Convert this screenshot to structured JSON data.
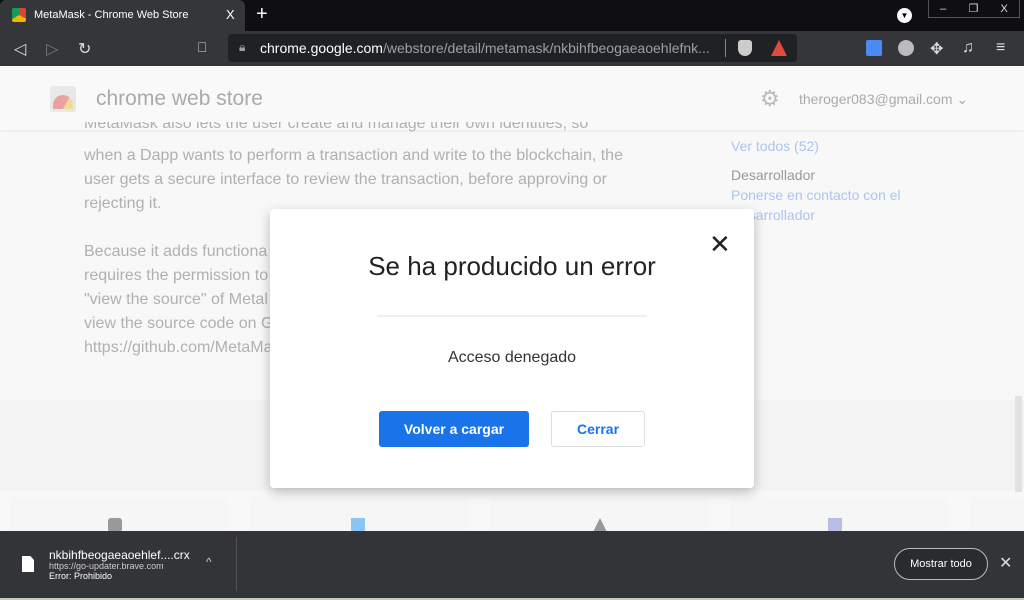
{
  "browser": {
    "tab_title": "MetaMask - Chrome Web Store",
    "tab_close": "X",
    "new_tab": "+",
    "profile_icon": "▼",
    "window_controls": [
      "–",
      "❐",
      "X"
    ],
    "url_host": "chrome.google.com",
    "url_path": "/webstore/detail/metamask/nkbihfbeogaeaoehlefnk..."
  },
  "header": {
    "store_name": "chrome web store",
    "account": "theroger083@gmail.com",
    "account_caret": "⌄"
  },
  "content": {
    "paragraphs": [
      "MetaMask also lets the user create and manage their own identities, so",
      "when a Dapp wants to perform a transaction and write to the blockchain, the",
      "user gets a secure interface to review the transaction, before approving or",
      "rejecting it.",
      "Because it adds functiona",
      "requires the permission to",
      "\"view the source\" of Metal",
      "view the source code on G",
      "https://github.com/MetaMa"
    ],
    "sidebar": {
      "see_all": "Ver todos (52)",
      "developer_label": "Desarrollador",
      "contact_line1": "Ponerse en contacto con el",
      "contact_line2": "esarrollador"
    }
  },
  "dialog": {
    "title": "Se ha producido un error",
    "message": "Acceso denegado",
    "reload_label": "Volver a cargar",
    "close_label": "Cerrar",
    "close_icon": "✕"
  },
  "download": {
    "filename": "nkbihfbeogaeaoehlef....crx",
    "source": "https://go-updater.brave.com",
    "status": "Error: Prohibido",
    "caret": "^",
    "show_all": "Mostrar todo",
    "close": "✕"
  },
  "colors": {
    "accent": "#1a73e8",
    "toolbar": "#35363a",
    "download_bar": "#333438"
  }
}
